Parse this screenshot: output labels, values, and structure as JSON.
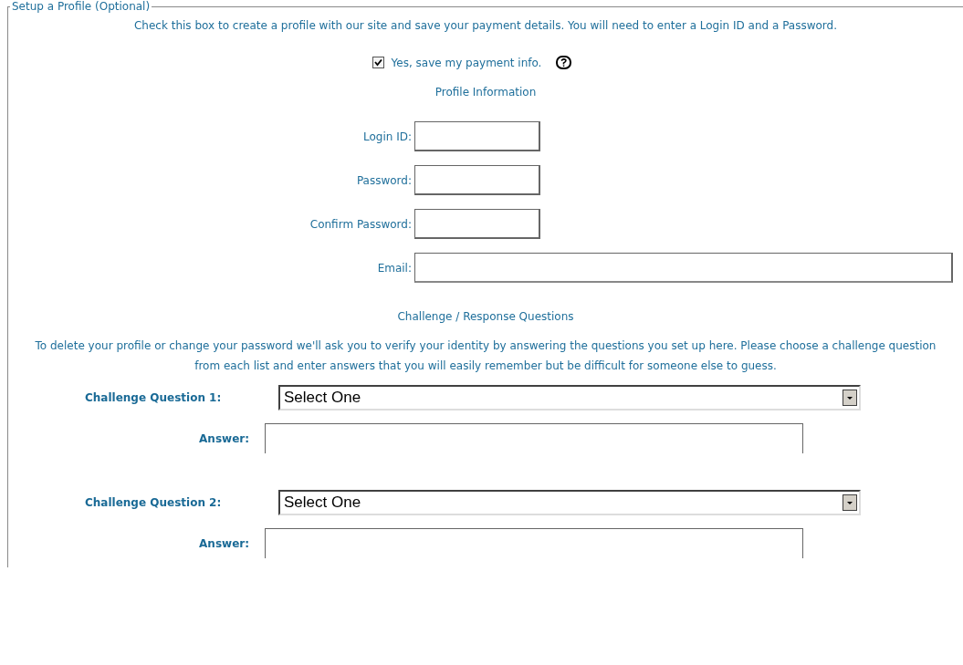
{
  "section": {
    "legend": "Setup a Profile (Optional)",
    "intro": "Check this box to create a profile with our site and save your payment details. You will need to enter a Login ID and a Password.",
    "save_checkbox": {
      "label": "Yes, save my payment info.",
      "checked": true
    },
    "profile_heading": "Profile Information",
    "profile_fields": [
      {
        "label": "Login ID:",
        "kind": "short"
      },
      {
        "label": "Password:",
        "kind": "short"
      },
      {
        "label": "Confirm Password:",
        "kind": "short"
      },
      {
        "label": "Email:",
        "kind": "wide"
      }
    ],
    "challenge_heading": "Challenge / Response Questions",
    "challenge_intro": "To delete your profile or change your password we'll ask you to verify your identity by answering the questions you set up here. Please choose a challenge question from each list and enter answers that you will easily remember but be difficult for someone else to guess.",
    "questions": [
      {
        "label": "Challenge Question 1:",
        "value": "Select One",
        "answer_label": "Answer:"
      },
      {
        "label": "Challenge Question 2:",
        "value": "Select One",
        "answer_label": "Answer:"
      }
    ]
  }
}
